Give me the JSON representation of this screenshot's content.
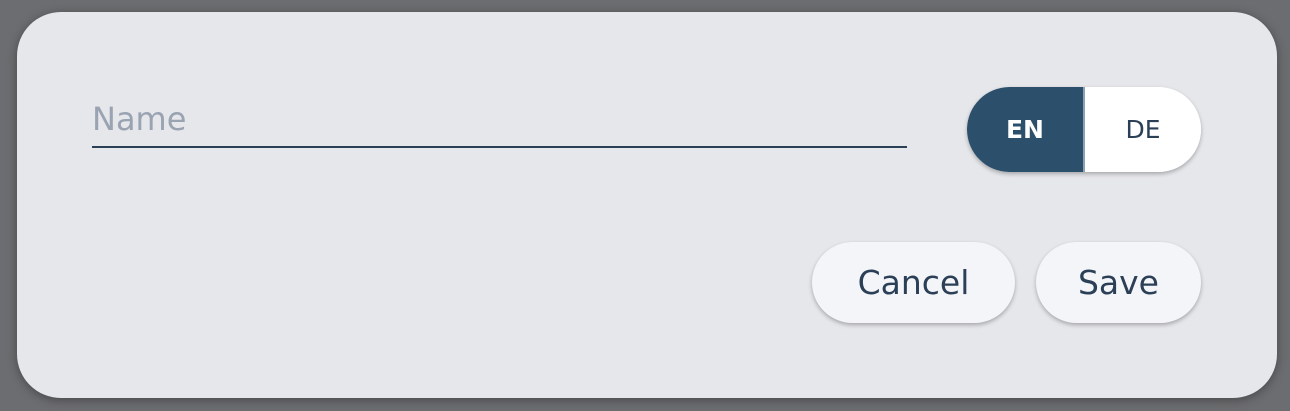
{
  "form": {
    "name_value": "",
    "name_placeholder": "Name"
  },
  "language_toggle": {
    "options": [
      {
        "label": "EN",
        "selected": true
      },
      {
        "label": "DE",
        "selected": false
      }
    ]
  },
  "actions": {
    "cancel_label": "Cancel",
    "save_label": "Save"
  },
  "colors": {
    "accent": "#2c4f6b",
    "text": "#2b3f57",
    "dialog_background": "#e6e7eb",
    "overlay": "#6c6d70"
  }
}
